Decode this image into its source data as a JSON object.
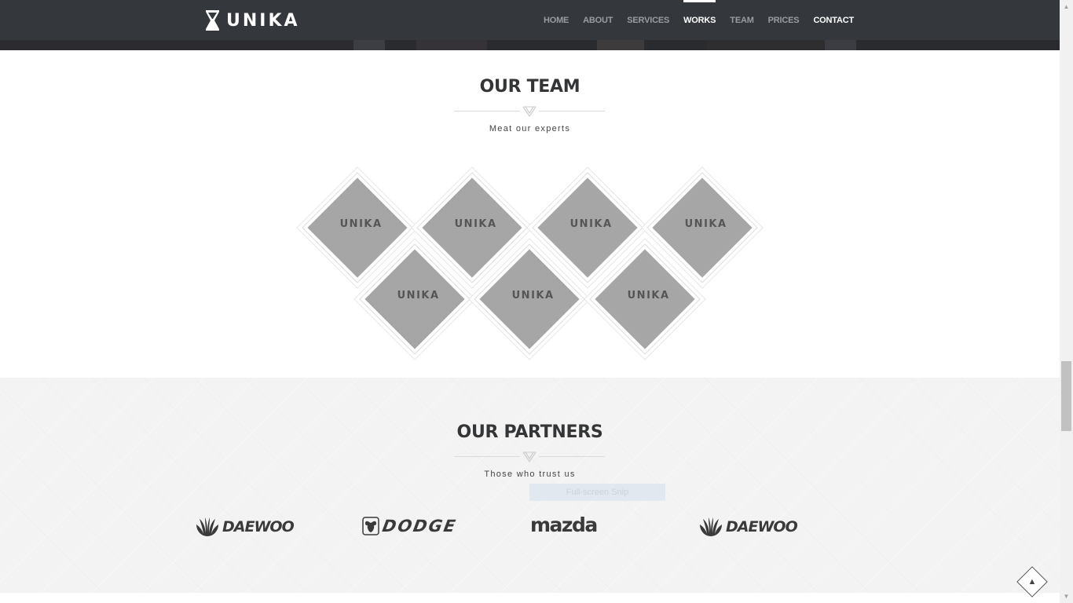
{
  "header": {
    "brand": "UNIKA",
    "logo_icon": "hourglass-icon",
    "menu": [
      {
        "label": "HOME",
        "state": "normal"
      },
      {
        "label": "ABOUT",
        "state": "normal"
      },
      {
        "label": "SERVICES",
        "state": "normal"
      },
      {
        "label": "WORKS",
        "state": "active"
      },
      {
        "label": "TEAM",
        "state": "normal"
      },
      {
        "label": "PRICES",
        "state": "normal"
      },
      {
        "label": "CONTACT",
        "state": "bright"
      }
    ]
  },
  "team": {
    "title": "OUR TEAM",
    "subtitle": "Meat our experts",
    "divider_icon": "chevron-emblem-icon",
    "members": [
      {
        "label": "UNIKA"
      },
      {
        "label": "UNIKA"
      },
      {
        "label": "UNIKA"
      },
      {
        "label": "UNIKA"
      },
      {
        "label": "UNIKA"
      },
      {
        "label": "UNIKA"
      },
      {
        "label": "UNIKA"
      }
    ]
  },
  "partners": {
    "title": "OUR PARTNERS",
    "subtitle": "Those who trust us",
    "divider_icon": "chevron-emblem-icon",
    "overlay_badge": "Full-screen Snip",
    "logos": [
      {
        "name": "DAEWOO",
        "icon": "daewoo-shell-icon"
      },
      {
        "name": "DODGE",
        "icon": "ram-head-icon"
      },
      {
        "name": "mazda",
        "icon": ""
      },
      {
        "name": "DAEWOO",
        "icon": "daewoo-shell-icon"
      }
    ]
  },
  "back_to_top": {
    "icon": "arrow-up-icon"
  },
  "colors": {
    "navbar": "#34373c",
    "menu_text": "#9a9ca0",
    "menu_active": "#ffffff",
    "diamond_fill": "#a6a6a6",
    "partners_bg": "#f3f3f3"
  }
}
